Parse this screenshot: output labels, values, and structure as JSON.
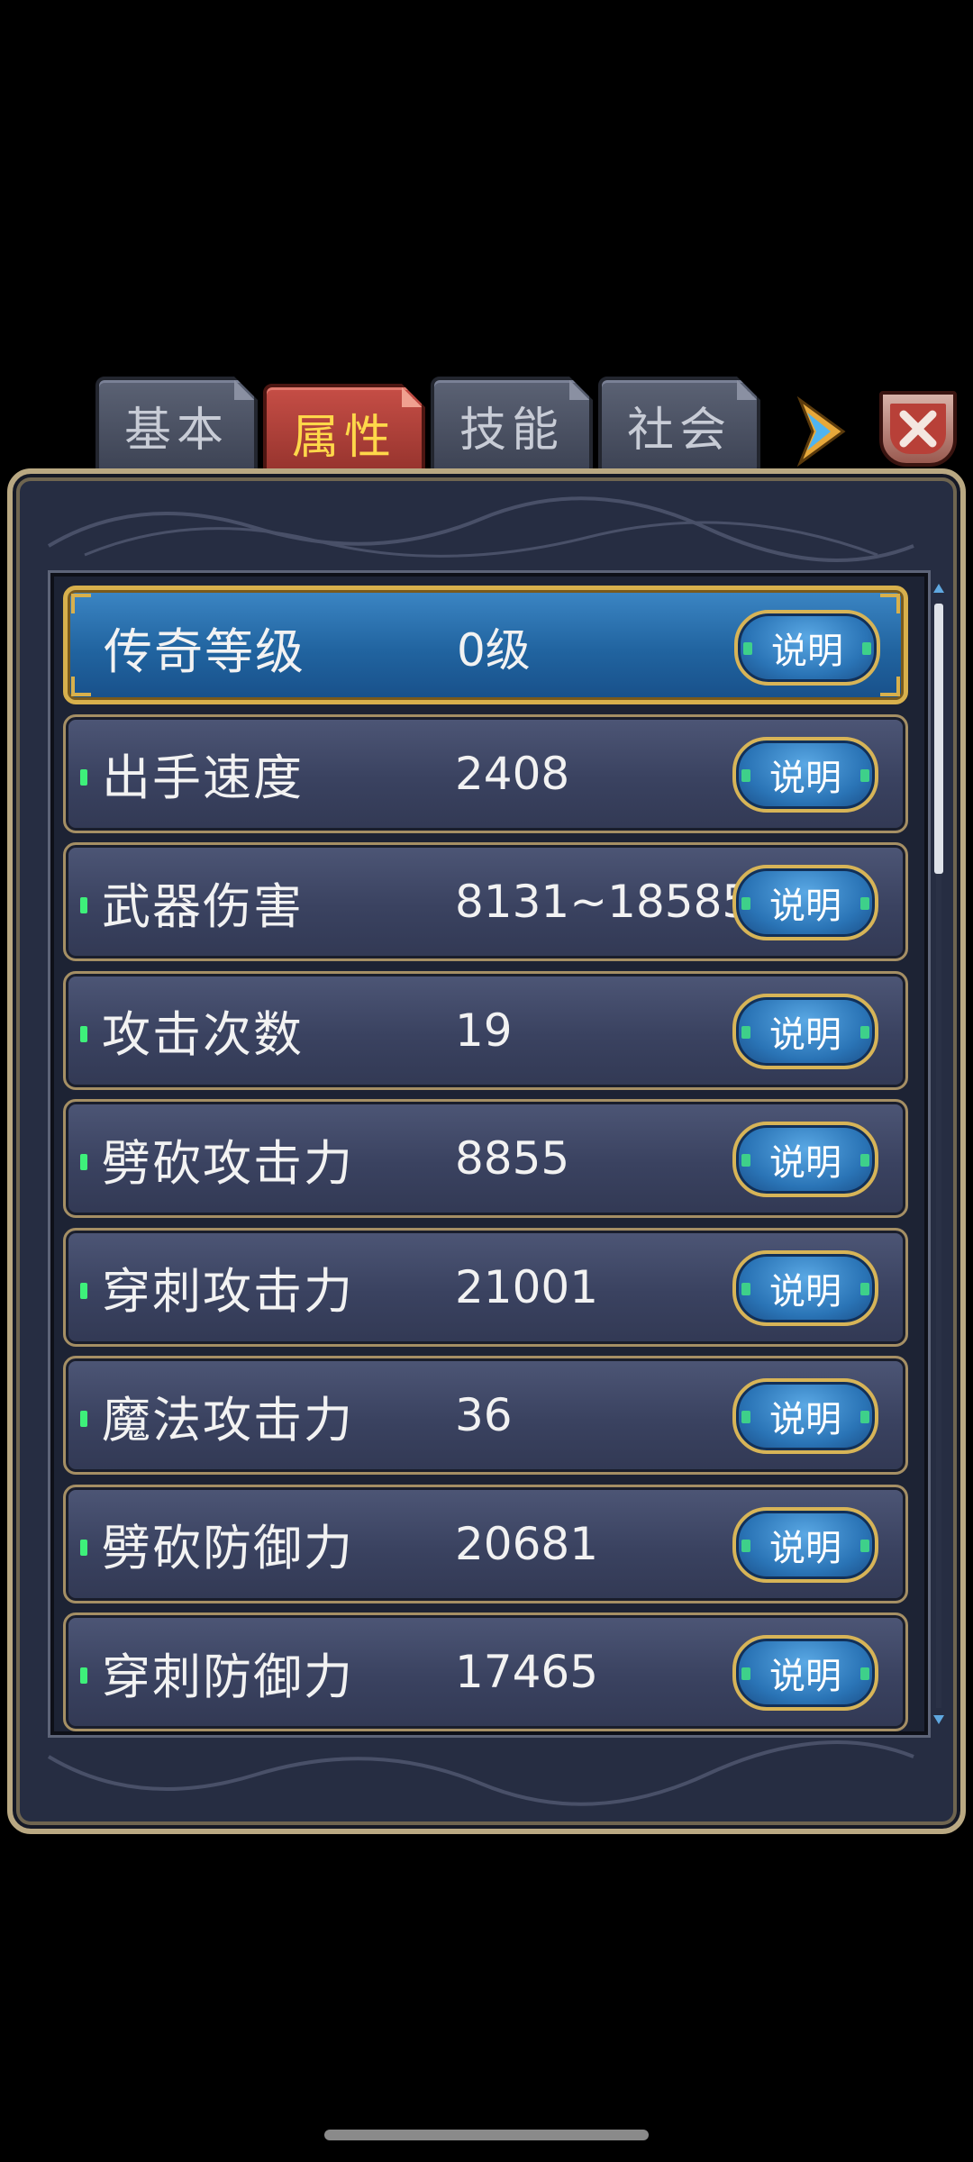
{
  "tabs": [
    {
      "label": "基本",
      "active": false
    },
    {
      "label": "属性",
      "active": true
    },
    {
      "label": "技能",
      "active": false
    },
    {
      "label": "社会",
      "active": false
    }
  ],
  "help_label": "说明",
  "icons": {
    "arrow": "next-arrow-icon",
    "close": "close-icon"
  },
  "colors": {
    "active_tab": "#b23e37",
    "active_tab_text": "#ffd84a",
    "selected_row": "#2164a0",
    "row": "#3a4260",
    "gold_border": "#d8b04c",
    "pip_green": "#3ef07a"
  },
  "attributes": [
    {
      "name": "传奇等级",
      "value": "0级",
      "selected": true
    },
    {
      "name": "出手速度",
      "value": "2408"
    },
    {
      "name": "武器伤害",
      "value": "8131~18585"
    },
    {
      "name": "攻击次数",
      "value": "19"
    },
    {
      "name": "劈砍攻击力",
      "value": "8855"
    },
    {
      "name": "穿刺攻击力",
      "value": "21001"
    },
    {
      "name": "魔法攻击力",
      "value": "36"
    },
    {
      "name": "劈砍防御力",
      "value": "20681"
    },
    {
      "name": "穿刺防御力",
      "value": "17465"
    }
  ]
}
